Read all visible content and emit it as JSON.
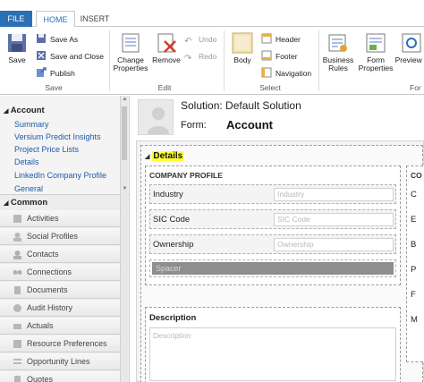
{
  "ribbon_tabs": {
    "file": "FILE",
    "home": "HOME",
    "insert": "INSERT"
  },
  "ribbon": {
    "save": "Save",
    "save_as": "Save As",
    "save_and_close": "Save and Close",
    "publish": "Publish",
    "save_group": "Save",
    "change_properties": "Change Properties",
    "remove": "Remove",
    "undo": "Undo",
    "redo": "Redo",
    "edit_group": "Edit",
    "body": "Body",
    "header": "Header",
    "footer": "Footer",
    "navigation": "Navigation",
    "select_group": "Select",
    "business_rules": "Business Rules",
    "form_properties": "Form Properties",
    "preview": "Preview",
    "form_group_partial": "For"
  },
  "nav": {
    "section_title": "Account",
    "links": [
      "Summary",
      "Versium Predict Insights",
      "Project Price Lists",
      "Details",
      "LinkedIn Company Profile",
      "General"
    ],
    "common_title": "Common",
    "common_items": [
      "Activities",
      "Social Profiles",
      "Contacts",
      "Connections",
      "Documents",
      "Audit History",
      "Actuals",
      "Resource Preferences",
      "Opportunity Lines",
      "Quotes"
    ]
  },
  "header": {
    "solution": "Solution: Default Solution",
    "form_label": "Form:",
    "form_name": "Account"
  },
  "form": {
    "tab_name": "Details",
    "company_profile": {
      "title": "COMPANY PROFILE",
      "fields": [
        {
          "label": "Industry",
          "placeholder": "Industry"
        },
        {
          "label": "SIC Code",
          "placeholder": "SIC Code"
        },
        {
          "label": "Ownership",
          "placeholder": "Ownership"
        }
      ],
      "spacer": "Spacer"
    },
    "description": {
      "label": "Description",
      "placeholder": "Description"
    },
    "right_section": {
      "title_partial": "CO",
      "letters": [
        "C",
        "E",
        "B",
        "P",
        "F",
        "M"
      ]
    }
  },
  "colors": {
    "accent": "#2b6fb6",
    "link": "#1f5aa6",
    "highlight": "#ffff33"
  }
}
